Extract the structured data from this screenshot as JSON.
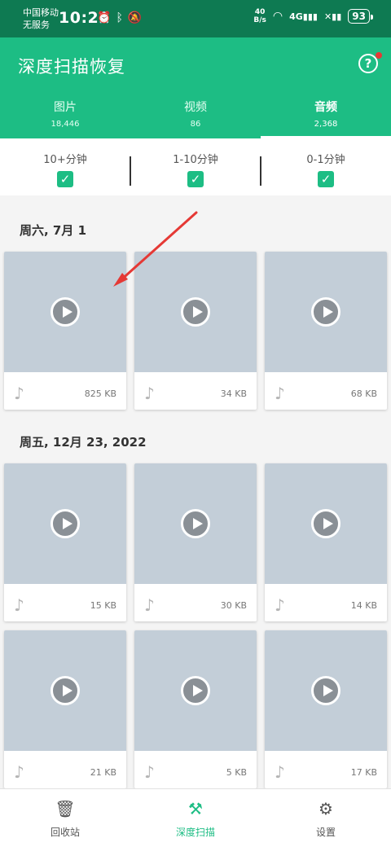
{
  "status_bar": {
    "carrier_line1": "中国移动",
    "carrier_line2": "无服务",
    "time": "10:22",
    "net_speed_value": "40",
    "net_speed_unit": "B/s",
    "battery": "93"
  },
  "header": {
    "title": "深度扫描恢复",
    "help_label": "?"
  },
  "tabs": [
    {
      "label": "图片",
      "count": "18,446"
    },
    {
      "label": "视频",
      "count": "86"
    },
    {
      "label": "音频",
      "count": "2,368"
    }
  ],
  "filters": [
    {
      "label": "10+分钟",
      "checked": true
    },
    {
      "label": "1-10分钟",
      "checked": true
    },
    {
      "label": "0-1分钟",
      "checked": true
    }
  ],
  "sections": [
    {
      "title": "周六, 7月 1",
      "items": [
        "825 KB",
        "34 KB",
        "68 KB"
      ]
    },
    {
      "title": "周五, 12月 23, 2022",
      "items": [
        "15 KB",
        "30 KB",
        "14 KB",
        "21 KB",
        "5 KB",
        "17 KB"
      ]
    }
  ],
  "bottom_nav": [
    {
      "label": "回收站",
      "icon": "trash-icon"
    },
    {
      "label": "深度扫描",
      "icon": "drill-scan-icon",
      "active": true
    },
    {
      "label": "设置",
      "icon": "gear-icon"
    }
  ],
  "colors": {
    "accent": "#1dbd84",
    "status_bar": "#0e7a52",
    "thumbnail": "#c3ced8",
    "annotation_arrow": "#e53935"
  }
}
